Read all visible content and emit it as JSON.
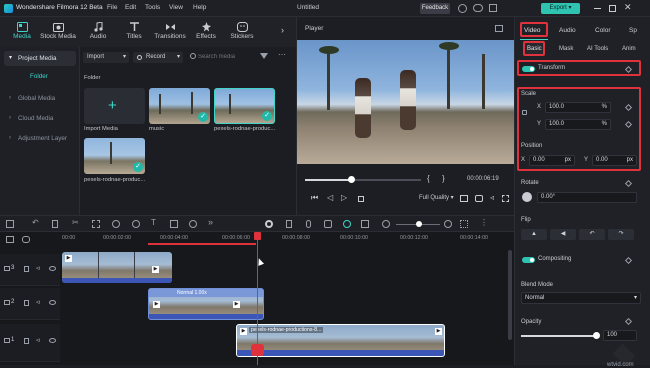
{
  "app": {
    "title": "Wondershare Filmora 12 Beta",
    "project_title": "Untitled",
    "feedback": "Feedback",
    "export": "Export"
  },
  "menu": [
    "File",
    "Edit",
    "Tools",
    "View",
    "Help"
  ],
  "toolbar": [
    {
      "label": "Media",
      "icon": "media-icon",
      "active": true
    },
    {
      "label": "Stock Media",
      "icon": "stock-media-icon"
    },
    {
      "label": "Audio",
      "icon": "audio-icon"
    },
    {
      "label": "Titles",
      "icon": "titles-icon"
    },
    {
      "label": "Transitions",
      "icon": "transitions-icon"
    },
    {
      "label": "Effects",
      "icon": "effects-icon"
    },
    {
      "label": "Stickers",
      "icon": "stickers-icon"
    }
  ],
  "sidebar": {
    "items": [
      {
        "label": "Project Media"
      },
      {
        "label": "Folder"
      },
      {
        "label": "Global Media"
      },
      {
        "label": "Cloud Media"
      },
      {
        "label": "Adjustment Layer"
      }
    ]
  },
  "media": {
    "import_label": "Import",
    "record_label": "Record",
    "search_placeholder": "Search media",
    "folder_label": "Folder",
    "items": [
      {
        "label": "Import Media"
      },
      {
        "label": "music"
      },
      {
        "label": "pexels-rodnae-produc..."
      },
      {
        "label": "pexels-rodnae-produc..."
      }
    ]
  },
  "player": {
    "label": "Player",
    "timecode": "00:00:06:19",
    "quality": "Full Quality",
    "progress": 0.4
  },
  "props": {
    "tabs": [
      "Video",
      "Audio",
      "Color",
      "Sp"
    ],
    "subtabs": [
      "Basic",
      "Mask",
      "AI Tools",
      "Anim"
    ],
    "transform": "Transform",
    "scale": "Scale",
    "scale_x": "100.0",
    "scale_y": "100.0",
    "percent": "%",
    "position": "Position",
    "pos_x": "0.00",
    "pos_y": "0.00",
    "px": "px",
    "rotate": "Rotate",
    "rotate_val": "0.00°",
    "flip": "Flip",
    "compositing": "Compositing",
    "blend_mode": "Blend Mode",
    "blend_value": "Normal",
    "opacity": "Opacity",
    "opacity_val": "100",
    "x": "X",
    "y": "Y"
  },
  "timeline": {
    "timecodes": [
      "00:00",
      "00:00:02:00",
      "00:00:04:00",
      "00:00:06:00",
      "00:00:08:00",
      "00:00:10:00",
      "00:00:12:00",
      "00:00:14:00"
    ],
    "tracks": [
      "3",
      "2",
      "1"
    ],
    "clip_label": "Normal 1.00x",
    "clip3_label": "pexels-rodnae-productions-8..."
  },
  "watermark": "wtvid.com",
  "colors": {
    "accent": "#3fd6c8",
    "highlight": "#e0323c",
    "export": "#2fc4b2"
  }
}
